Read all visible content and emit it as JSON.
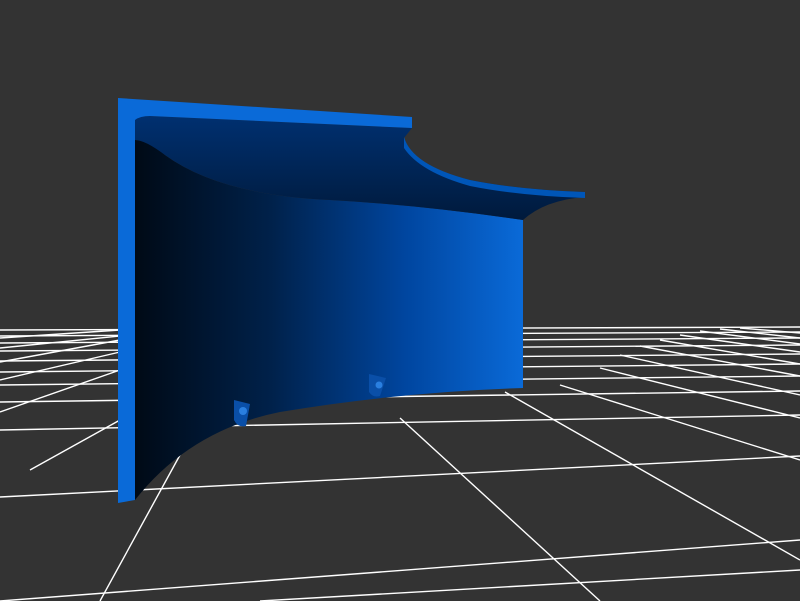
{
  "viewport": {
    "background_color": "#333333",
    "grid_color": "#ffffff",
    "grid_visible": true
  },
  "model": {
    "shape": "curved-bracket-part",
    "color_light": "#0a6ad8",
    "color_dark": "#000e1c",
    "holes": 2
  }
}
